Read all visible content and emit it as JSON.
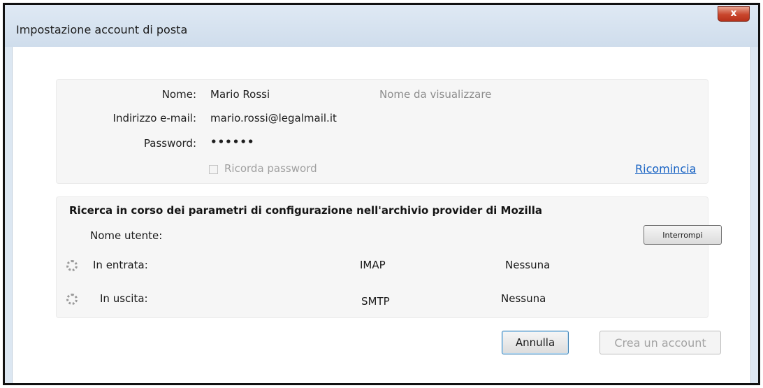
{
  "window": {
    "title": "Impostazione account di posta",
    "close_glyph": "x"
  },
  "account": {
    "name_label": "Nome:",
    "name_value": "Mario Rossi",
    "name_hint": "Nome da visualizzare",
    "email_label": "Indirizzo e-mail:",
    "email_value": "mario.rossi@legalmail.it",
    "password_label": "Password:",
    "password_value": "••••••",
    "remember_label": "Ricorda password",
    "remember_checked": false,
    "restart_link": "Ricomincia"
  },
  "config": {
    "status_text": "Ricerca in corso dei parametri di configurazione nell'archivio provider di Mozilla",
    "username_label": "Nome utente:",
    "stop_button": "Interrompi",
    "incoming_label": "In entrata:",
    "incoming_protocol": "IMAP",
    "incoming_security": "Nessuna",
    "outgoing_label": "In uscita:",
    "outgoing_protocol": "SMTP",
    "outgoing_security": "Nessuna"
  },
  "buttons": {
    "cancel": "Annulla",
    "create": "Crea un account"
  },
  "icons": {
    "close": "close-icon",
    "spinner": "loading-spinner-icon"
  },
  "colors": {
    "link": "#1a64c4",
    "close_button": "#c8452c",
    "frame": "#dce7f2"
  }
}
